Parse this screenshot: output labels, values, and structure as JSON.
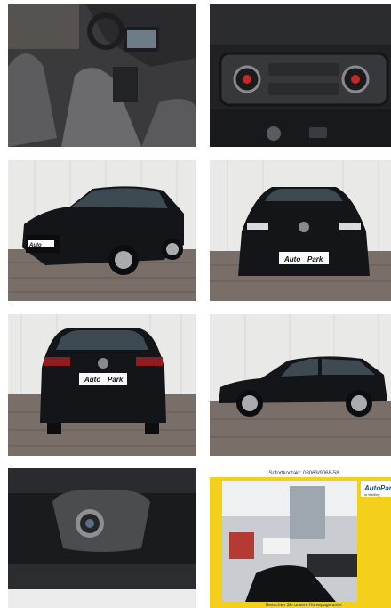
{
  "gallery": {
    "photos": [
      {
        "name": "interior-front-seats"
      },
      {
        "name": "climate-control-panel"
      },
      {
        "name": "front-three-quarter"
      },
      {
        "name": "front-view"
      },
      {
        "name": "rear-view"
      },
      {
        "name": "side-view"
      },
      {
        "name": "rear-camera"
      },
      {
        "name": "dealer-showroom"
      }
    ]
  },
  "plate": {
    "brand": "Auto",
    "brand_suffix": "Park"
  },
  "dealer_ad": {
    "contact": "Sofortkontakt: 08063/9068-58",
    "logo": "Auto",
    "logo_suffix": "Park",
    "location": "in Weiting",
    "footer": "Besuchen Sie unsere Homepage unter"
  },
  "colors": {
    "car_black": "#141518",
    "ad_yellow": "#f4d01c",
    "wall": "#e9e9e7",
    "pavement": "#7a6e68"
  }
}
